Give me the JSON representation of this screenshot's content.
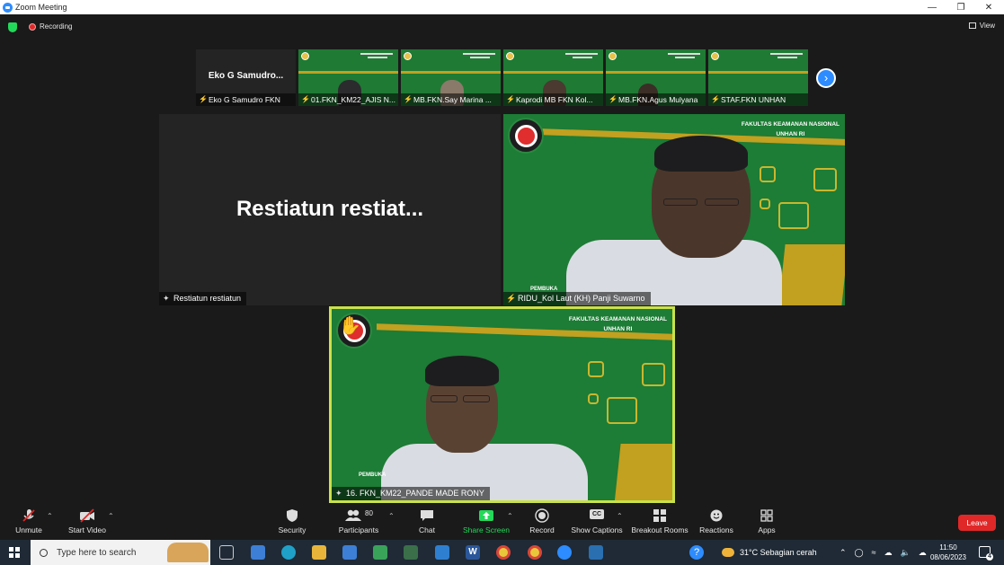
{
  "window": {
    "title": "Zoom Meeting"
  },
  "meeting": {
    "recording_label": "Recording",
    "view_label": "View"
  },
  "thumbnails": [
    {
      "big_name": "Eko G Samudro...",
      "label": "Eko G Samudro FKN",
      "type": "avatar"
    },
    {
      "label": "01.FKN_KM22_AJIS N...",
      "type": "video"
    },
    {
      "label": "MB.FKN.Say Marina ...",
      "type": "video"
    },
    {
      "label": "Kaprodi MB FKN Kol...",
      "type": "video"
    },
    {
      "label": "MB.FKN.Agus Mulyana",
      "type": "video"
    },
    {
      "label": "STAF.FKN UNHAN",
      "type": "video"
    }
  ],
  "tiles": {
    "left": {
      "display_name": "Restiatun  restiat...",
      "label": "Restiatun restiatun"
    },
    "right": {
      "label": "RIDU_Kol Laut (KH) Panji Suwarno",
      "org_line1": "FAKULTAS KEAMANAN NASIONAL",
      "org_line2": "UNHAN RI",
      "pv_text": "PEMBUKA"
    },
    "bottom": {
      "label": "16. FKN_KM22_PANDE MADE RONY",
      "org_line1": "FAKULTAS KEAMANAN NASIONAL",
      "org_line2": "UNHAN RI",
      "pv_text": "PEMBUKA"
    }
  },
  "toolbar": {
    "unmute": "Unmute",
    "start_video": "Start Video",
    "security": "Security",
    "participants": "Participants",
    "participants_count": "80",
    "chat": "Chat",
    "share_screen": "Share Screen",
    "record": "Record",
    "show_captions": "Show Captions",
    "captions_glyph": "CC",
    "breakout_rooms": "Breakout Rooms",
    "reactions": "Reactions",
    "apps": "Apps",
    "leave": "Leave"
  },
  "taskbar": {
    "search_placeholder": "Type here to search",
    "weather": "31°C  Sebagian cerah",
    "time": "11:50",
    "date": "08/06/2023",
    "notifications": "4",
    "word_glyph": "W"
  },
  "colors": {
    "zoom_blue": "#2d8cff",
    "share_green": "#23d959",
    "leave_red": "#e02828",
    "slide_green": "#1d7c35",
    "slide_gold": "#c2a020",
    "active_speaker": "#c9e24a"
  }
}
